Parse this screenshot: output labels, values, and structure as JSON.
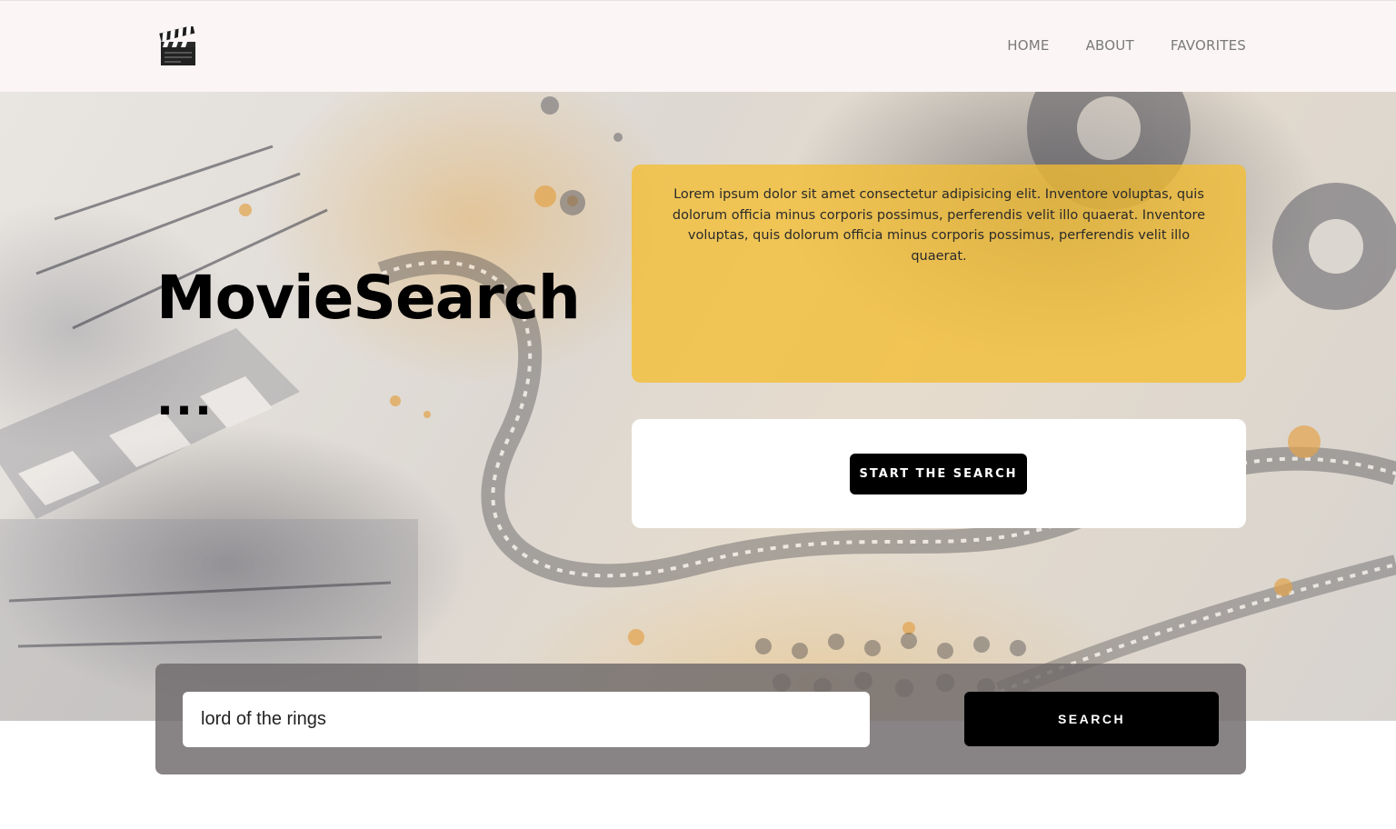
{
  "nav": {
    "logo_icon": "clapperboard-icon",
    "items": [
      {
        "label": "HOME"
      },
      {
        "label": "ABOUT"
      },
      {
        "label": "FAVORITES"
      }
    ]
  },
  "hero": {
    "title": "MovieSearch",
    "ellipsis": "...",
    "info_text": "Lorem ipsum dolor sit amet consectetur adipisicing elit. Inventore voluptas, quis dolorum officia minus corporis possimus, perferendis velit illo quaerat. Inventore voluptas, quis dolorum officia minus corporis possimus, perferendis velit illo quaerat.",
    "cta_label": "START THE SEARCH"
  },
  "search": {
    "value": "lord of the rings",
    "button_label": "SEARCH"
  },
  "colors": {
    "nav_bg": "#fbf6f5",
    "accent_yellow": "#f4be32",
    "button_bg": "#000000"
  }
}
